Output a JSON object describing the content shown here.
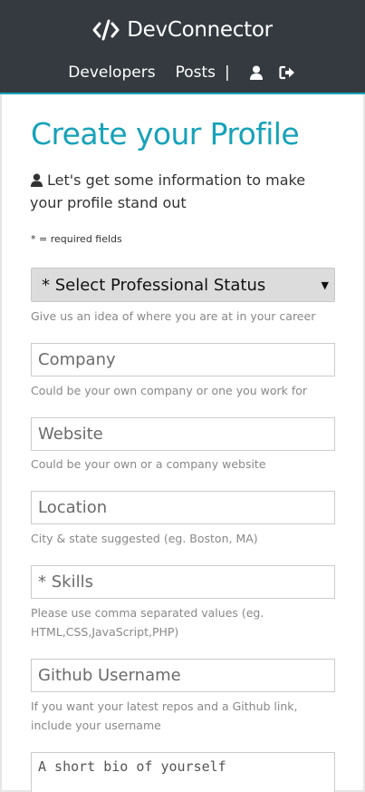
{
  "navbar": {
    "brand": "DevConnector",
    "brand_icon": "code-icon",
    "links": [
      {
        "label": "Developers"
      },
      {
        "label": "Posts"
      }
    ],
    "separator": "|",
    "icons": [
      "user-icon",
      "sign-out-icon"
    ],
    "background": "#343a40",
    "accent": "#17a2b8"
  },
  "page": {
    "title": "Create your Profile",
    "lead": "Let's get some information to make your profile stand out",
    "required_note": "* = required fields"
  },
  "form": {
    "status": {
      "selected": "* Select Professional Status",
      "hint": "Give us an idea of where you are at in your career"
    },
    "company": {
      "placeholder": "Company",
      "hint": "Could be your own company or one you work for"
    },
    "website": {
      "placeholder": "Website",
      "hint": "Could be your own or a company website"
    },
    "location": {
      "placeholder": "Location",
      "hint": "City & state suggested (eg. Boston, MA)"
    },
    "skills": {
      "placeholder": "* Skills",
      "hint": "Please use comma separated values (eg. HTML,CSS,JavaScript,PHP)"
    },
    "github": {
      "placeholder": "Github Username",
      "hint": "If you want your latest repos and a Github link, include your username"
    },
    "bio": {
      "placeholder": "A short bio of yourself"
    }
  }
}
